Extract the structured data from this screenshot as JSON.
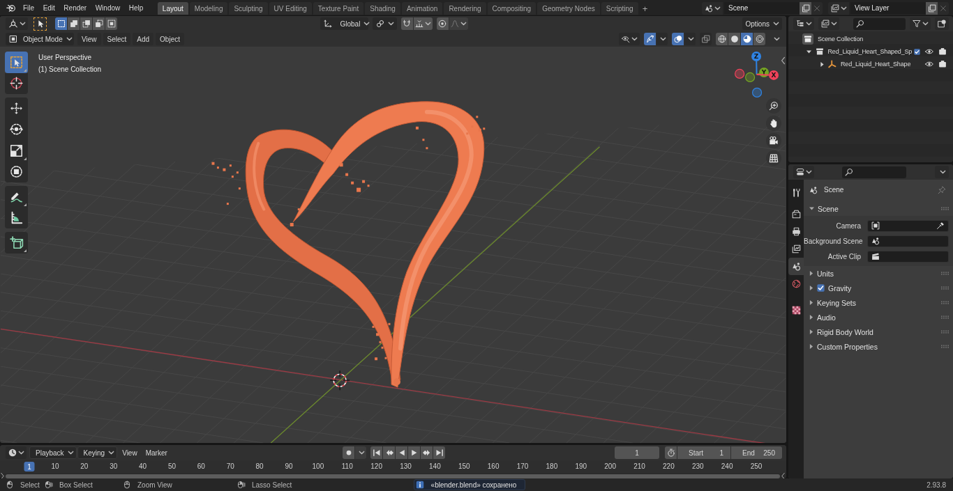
{
  "top_bar": {
    "menus": [
      "File",
      "Edit",
      "Render",
      "Window",
      "Help"
    ],
    "workspaces": [
      {
        "label": "Layout",
        "selected": true
      },
      {
        "label": "Modeling",
        "selected": false
      },
      {
        "label": "Sculpting",
        "selected": false
      },
      {
        "label": "UV Editing",
        "selected": false
      },
      {
        "label": "Texture Paint",
        "selected": false
      },
      {
        "label": "Shading",
        "selected": false
      },
      {
        "label": "Animation",
        "selected": false
      },
      {
        "label": "Rendering",
        "selected": false
      },
      {
        "label": "Compositing",
        "selected": false
      },
      {
        "label": "Geometry Nodes",
        "selected": false
      },
      {
        "label": "Scripting",
        "selected": false
      }
    ],
    "add_workspace": "+",
    "scene": "Scene",
    "view_layer": "View Layer"
  },
  "viewport": {
    "tool_header": {
      "select_modes": [
        {
          "kind": "set",
          "selected": true
        },
        {
          "kind": "extend",
          "selected": false
        },
        {
          "kind": "subtract",
          "selected": false
        },
        {
          "kind": "invert",
          "selected": false
        },
        {
          "kind": "intersect",
          "selected": false
        }
      ],
      "orientation": "Global",
      "snapping": {
        "on": false
      },
      "proportional": {
        "on": false
      },
      "options": "Options"
    },
    "header": {
      "mode": "Object Mode",
      "menus": [
        "View",
        "Select",
        "Add",
        "Object"
      ],
      "toggles": [
        {
          "kind": "gizmos",
          "on": true
        },
        {
          "kind": "overlays",
          "on": true
        },
        {
          "kind": "xray",
          "on": false
        }
      ],
      "shading": [
        {
          "kind": "wireframe",
          "selected": false
        },
        {
          "kind": "solid",
          "selected": false
        },
        {
          "kind": "material",
          "selected": true
        },
        {
          "kind": "rendered",
          "selected": false
        }
      ]
    },
    "toolbar": [
      {
        "tools": [
          {
            "kind": "select",
            "selected": true
          },
          {
            "kind": "cursor",
            "selected": false
          }
        ]
      },
      {
        "tools": [
          {
            "kind": "move",
            "selected": false
          },
          {
            "kind": "rotate",
            "selected": false
          },
          {
            "kind": "scale",
            "selected": false
          },
          {
            "kind": "transform",
            "selected": false
          }
        ]
      },
      {
        "tools": [
          {
            "kind": "annotate",
            "selected": false
          },
          {
            "kind": "measure",
            "selected": false
          }
        ]
      },
      {
        "tools": [
          {
            "kind": "add",
            "selected": false
          }
        ]
      }
    ],
    "overlay_text": [
      "User Perspective",
      "(1) Scene Collection"
    ],
    "gizmo_axes": [
      {
        "label": "Z",
        "color": "#2f83e3"
      },
      {
        "label": "Y",
        "color": "#76a523"
      },
      {
        "label": "X",
        "color": "#f0425a"
      }
    ],
    "navigation": [
      {
        "kind": "zoom"
      },
      {
        "kind": "pan"
      },
      {
        "kind": "camera"
      },
      {
        "kind": "ortho"
      }
    ]
  },
  "outliner": {
    "tree": [
      {
        "label": "Scene Collection",
        "kind": "scene",
        "children": [
          {
            "label": "Red_Liquid_Heart_Shaped_Sp",
            "kind": "collection",
            "expanded": true,
            "checked": true,
            "visible": true,
            "renderable": true,
            "children": [
              {
                "label": "Red_Liquid_Heart_Shape",
                "kind": "empty",
                "expanded": false,
                "visible": true,
                "renderable": true
              }
            ]
          }
        ]
      }
    ]
  },
  "properties": {
    "tabs": [
      {
        "kind": "tool",
        "selected": false
      },
      {
        "kind": "render",
        "selected": false
      },
      {
        "kind": "output",
        "selected": false
      },
      {
        "kind": "viewlayer",
        "selected": false
      },
      {
        "kind": "scene",
        "selected": true
      },
      {
        "kind": "world",
        "selected": false
      },
      {
        "kind": "texture",
        "selected": false
      }
    ],
    "context": "Scene",
    "panels": [
      {
        "label": "Scene",
        "expanded": true,
        "fields": [
          {
            "label": "Camera",
            "kind": "camera"
          },
          {
            "label": "Background Scene",
            "kind": "scene"
          },
          {
            "label": "Active Clip",
            "kind": "clip"
          }
        ]
      },
      {
        "label": "Units",
        "expanded": false
      },
      {
        "label": "Gravity",
        "expanded": false,
        "checked": true
      },
      {
        "label": "Keying Sets",
        "expanded": false
      },
      {
        "label": "Audio",
        "expanded": false
      },
      {
        "label": "Rigid Body World",
        "expanded": false
      },
      {
        "label": "Custom Properties",
        "expanded": false
      }
    ]
  },
  "timeline": {
    "menus": [
      {
        "label": "Playback",
        "kind": "dropdown"
      },
      {
        "label": "Keying",
        "kind": "dropdown"
      },
      {
        "label": "View",
        "kind": "menu"
      },
      {
        "label": "Marker",
        "kind": "menu"
      }
    ],
    "auto_keying": {
      "on": false
    },
    "current_frame": "1",
    "preview_range": {
      "on": false
    },
    "start_label": "Start",
    "start": "1",
    "end_label": "End",
    "end": "250",
    "playhead": "1",
    "ruler": [
      "10",
      "20",
      "30",
      "40",
      "50",
      "60",
      "70",
      "80",
      "90",
      "100",
      "110",
      "120",
      "130",
      "140",
      "150",
      "160",
      "170",
      "180",
      "190",
      "200",
      "210",
      "220",
      "230",
      "240",
      "250"
    ]
  },
  "status_bar": {
    "hints": [
      {
        "kind": "left",
        "label": "Select"
      },
      {
        "kind": "drag",
        "label": "Box Select"
      },
      {
        "kind": "middle",
        "label": "Zoom View"
      },
      {
        "kind": "right",
        "label": "Lasso Select"
      }
    ],
    "message": "«blender.blend» сохранено",
    "version": "2.93.8"
  }
}
